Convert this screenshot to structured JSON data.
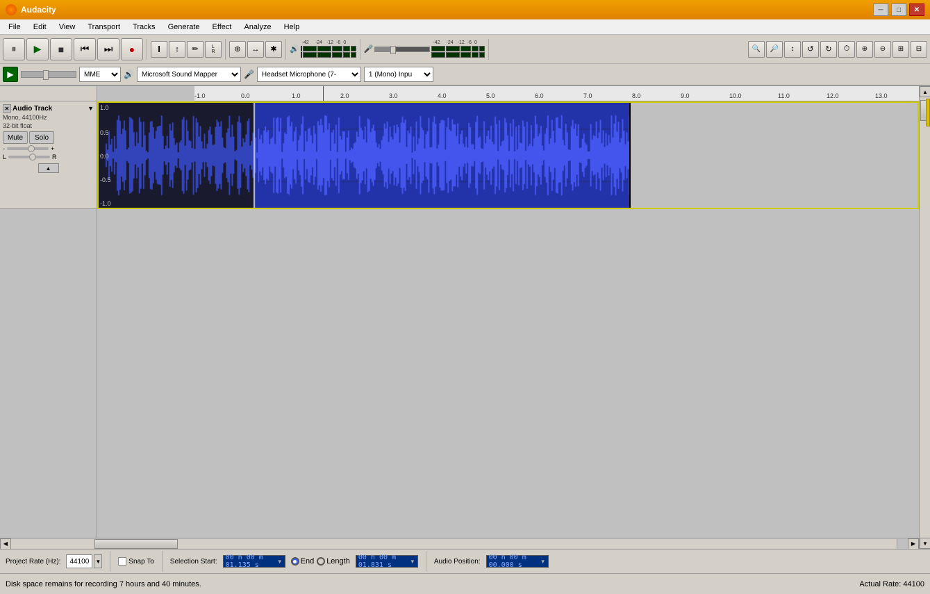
{
  "app": {
    "title": "Audacity",
    "logo_char": "🎵"
  },
  "titlebar": {
    "title": "Audacity",
    "min_btn": "─",
    "max_btn": "□",
    "close_btn": "✕"
  },
  "menu": {
    "items": [
      "File",
      "Edit",
      "View",
      "Transport",
      "Tracks",
      "Generate",
      "Effect",
      "Analyze",
      "Help"
    ]
  },
  "transport": {
    "pause_label": "⏸",
    "play_label": "▶",
    "stop_label": "■",
    "rewind_label": "⏮",
    "ff_label": "⏭",
    "record_label": "●"
  },
  "tools": {
    "select_icon": "I",
    "envelope_icon": "↕",
    "draw_icon": "✏",
    "lr_label": "L\nR",
    "zoom_icon": "🔍",
    "timeshift_icon": "↔",
    "multi_icon": "✱"
  },
  "audio_setup": {
    "host_label": "MME",
    "output_device": "Microsoft Sound Mapper",
    "input_icon": "🎤",
    "input_device": "Headset Microphone (7-",
    "input_channels": "1 (Mono) Inpu"
  },
  "meter": {
    "output_icon": "🔊",
    "db_scale": [
      "-42",
      "-24",
      "-12",
      "-6",
      "0"
    ],
    "db_scale2": [
      "-42",
      "-24",
      "-12",
      "-6",
      "0"
    ]
  },
  "track": {
    "name": "Audio Track",
    "info_mono": "Mono, 44100Hz",
    "info_bitdepth": "32-bit float",
    "mute_label": "Mute",
    "solo_label": "Solo",
    "gain_minus": "-",
    "gain_plus": "+",
    "pan_l": "L",
    "pan_r": "R",
    "collapse_icon": "▲"
  },
  "ruler": {
    "ticks": [
      "-1.0",
      "0.0",
      "1.0",
      "2.0",
      "3.0",
      "4.0",
      "5.0",
      "6.0",
      "7.0",
      "8.0",
      "9.0",
      "10.0",
      "11.0",
      "12.0",
      "13.0"
    ]
  },
  "bottom_toolbar": {
    "project_rate_label": "Project Rate (Hz):",
    "project_rate_value": "44100",
    "snap_to_label": "Snap To",
    "selection_start_label": "Selection Start:",
    "end_label": "End",
    "length_label": "Length",
    "audio_position_label": "Audio Position:",
    "sel_start_time": "00 h 00 m 01.135 s",
    "sel_end_time": "00 h 00 m 01.831 s",
    "audio_pos_time": "00 h 00 m 00.000 s"
  },
  "statusbar": {
    "message": "Disk space remains for recording 7 hours and 40 minutes.",
    "actual_rate": "Actual Rate: 44100"
  },
  "waveform": {
    "bg_color": "#1a1a2e",
    "wave_color": "#3333cc",
    "selected_color": "#2255ff",
    "unselected_bg": "#c0c0c0"
  }
}
